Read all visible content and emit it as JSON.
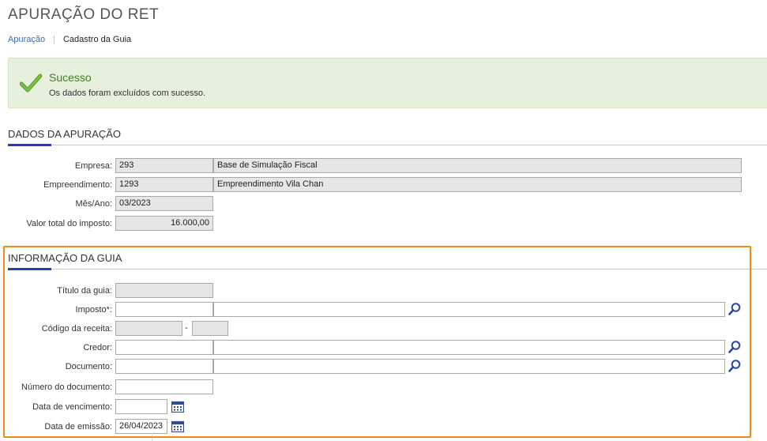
{
  "header": {
    "title": "APURAÇÃO DO RET",
    "breadcrumb": [
      "Apuração",
      "Cadastro da Guia"
    ]
  },
  "alert": {
    "title": "Sucesso",
    "message": "Os dados foram excluídos com sucesso.",
    "icon": "check-icon",
    "color": "#3f7f1f"
  },
  "dados_apuracao": {
    "title": "DADOS DA APURAÇÃO",
    "empresa": {
      "label": "Empresa:",
      "code": "293",
      "name": "Base de Simulação Fiscal"
    },
    "empreendimento": {
      "label": "Empreendimento:",
      "code": "1293",
      "name": "Empreendimento Vila Chan"
    },
    "mes_ano": {
      "label": "Mês/Ano:",
      "value": "03/2023"
    },
    "valor_total": {
      "label": "Valor total do imposto:",
      "value": "16.000,00"
    }
  },
  "informacao_guia": {
    "title": "INFORMAÇÃO DA GUIA",
    "titulo_guia": {
      "label": "Título da guia:",
      "value": ""
    },
    "imposto": {
      "label": "Imposto*:",
      "code": "",
      "name": ""
    },
    "codigo_receita": {
      "label": "Código da receita:",
      "value1": "",
      "separator": "-",
      "value2": ""
    },
    "credor": {
      "label": "Credor:",
      "code": "",
      "name": ""
    },
    "documento": {
      "label": "Documento:",
      "code": "",
      "name": ""
    },
    "numero_documento": {
      "label": "Número do documento:",
      "value": ""
    },
    "data_vencimento": {
      "label": "Data de vencimento:",
      "value": ""
    },
    "data_emissao": {
      "label": "Data de emissão:",
      "value": "26/04/2023"
    }
  },
  "colors": {
    "accent": "#2e3f99",
    "highlight": "#f08a1a",
    "alert_bg": "#e6f0dd",
    "link": "#3a6ea5"
  }
}
